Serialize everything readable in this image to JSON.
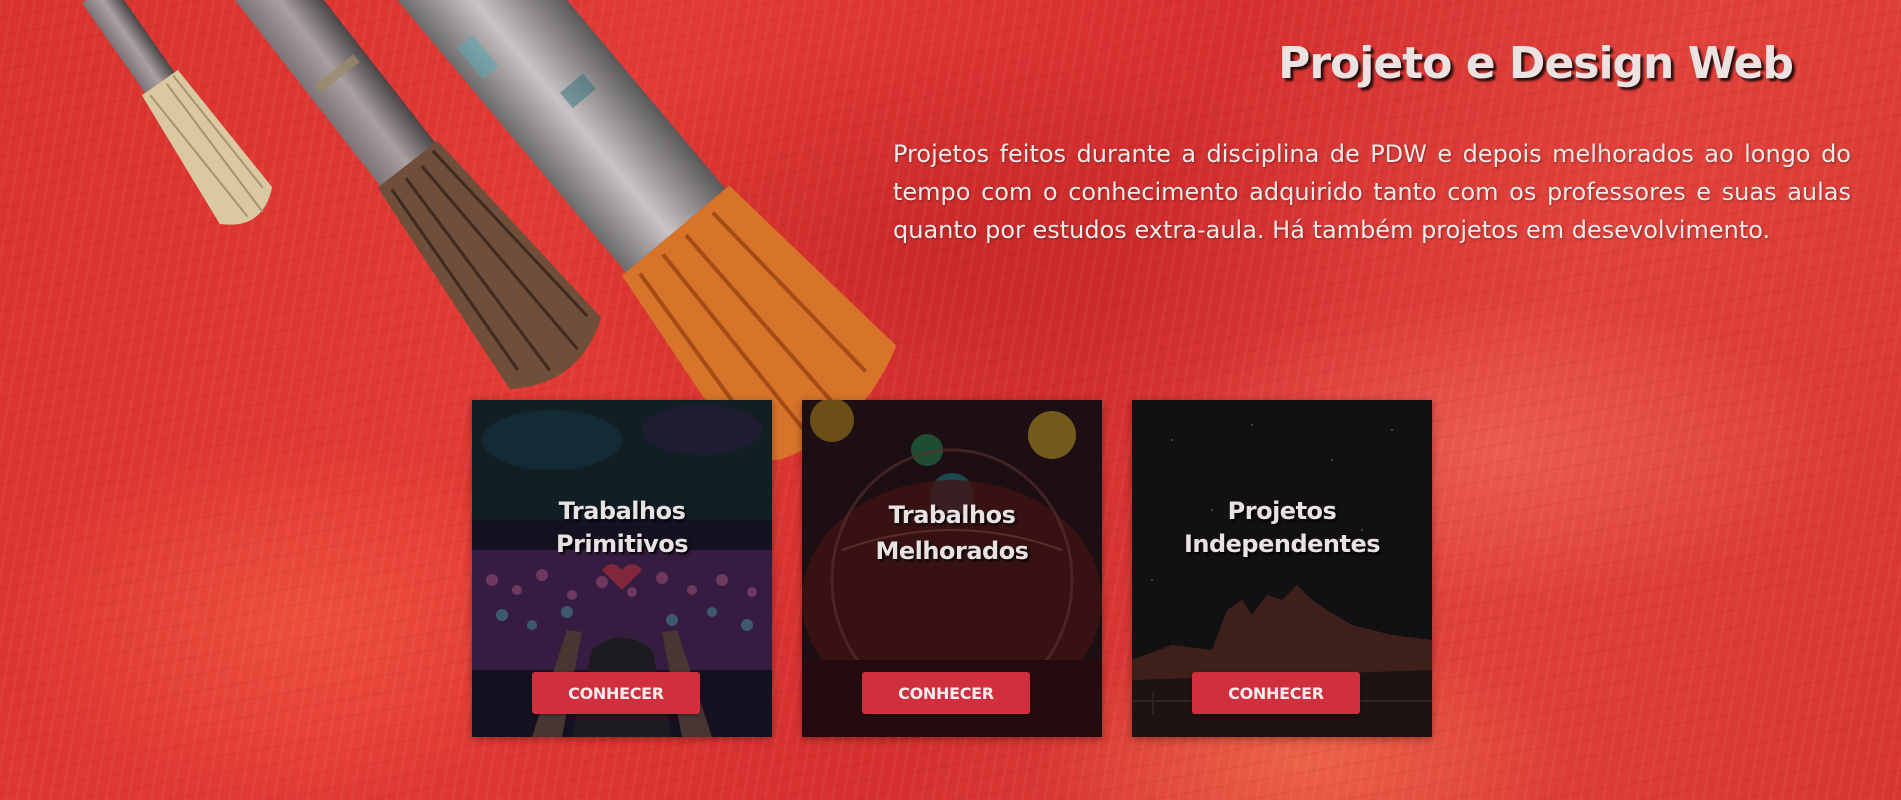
{
  "header": {
    "title": "Projeto e Design Web",
    "intro": "Projetos feitos durante a disciplina de PDW e depois melhorados ao longo do tempo com o conhecimento adquirido tanto com os professores e suas aulas quanto por estudos extra-aula. Há também projetos em desevolvimento."
  },
  "cards": [
    {
      "title": "Trabalhos\nPrimitivos",
      "button_label": "CONHECER"
    },
    {
      "title": "Trabalhos\nMelhorados",
      "button_label": "CONHECER"
    },
    {
      "title": "Projetos\nIndependentes",
      "button_label": "CONHECER"
    }
  ],
  "colors": {
    "background": "#dd3632",
    "button": "#d12e3e",
    "title_text": "#ece2e2"
  }
}
